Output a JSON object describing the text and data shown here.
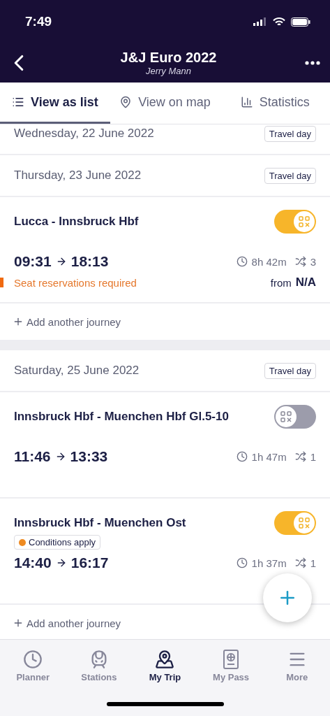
{
  "status_bar": {
    "time": "7:49"
  },
  "header": {
    "title": "J&J Euro 2022",
    "subtitle": "Jerry Mann"
  },
  "tabs": [
    {
      "label": "View as list",
      "selected": true
    },
    {
      "label": "View on map",
      "selected": false
    },
    {
      "label": "Statistics",
      "selected": false
    }
  ],
  "days": [
    {
      "date": "Wednesday, 22 June 2022",
      "badge": "Travel day"
    },
    {
      "date": "Thursday, 23 June 2022",
      "badge": "Travel day",
      "journeys": [
        {
          "route": "Lucca - Innsbruck Hbf",
          "on": true,
          "depart": "09:31",
          "arrive": "18:13",
          "duration": "8h 42m",
          "changes": "3",
          "warning": "Seat reservations required",
          "price_prefix": "from",
          "price": "N/A"
        }
      ],
      "add_label": "Add another journey"
    },
    {
      "date": "Saturday, 25 June 2022",
      "badge": "Travel day",
      "journeys": [
        {
          "route": "Innsbruck Hbf - Muenchen Hbf Gl.5-10",
          "on": false,
          "depart": "11:46",
          "arrive": "13:33",
          "duration": "1h 47m",
          "changes": "1"
        },
        {
          "route": "Innsbruck Hbf - Muenchen Ost",
          "on": true,
          "condition": "Conditions apply",
          "depart": "14:40",
          "arrive": "16:17",
          "duration": "1h 37m",
          "changes": "1"
        }
      ],
      "add_label": "Add another journey"
    }
  ],
  "bottom_nav": [
    {
      "label": "Planner",
      "selected": false
    },
    {
      "label": "Stations",
      "selected": false
    },
    {
      "label": "My Trip",
      "selected": true
    },
    {
      "label": "My Pass",
      "selected": false
    },
    {
      "label": "More",
      "selected": false
    }
  ]
}
